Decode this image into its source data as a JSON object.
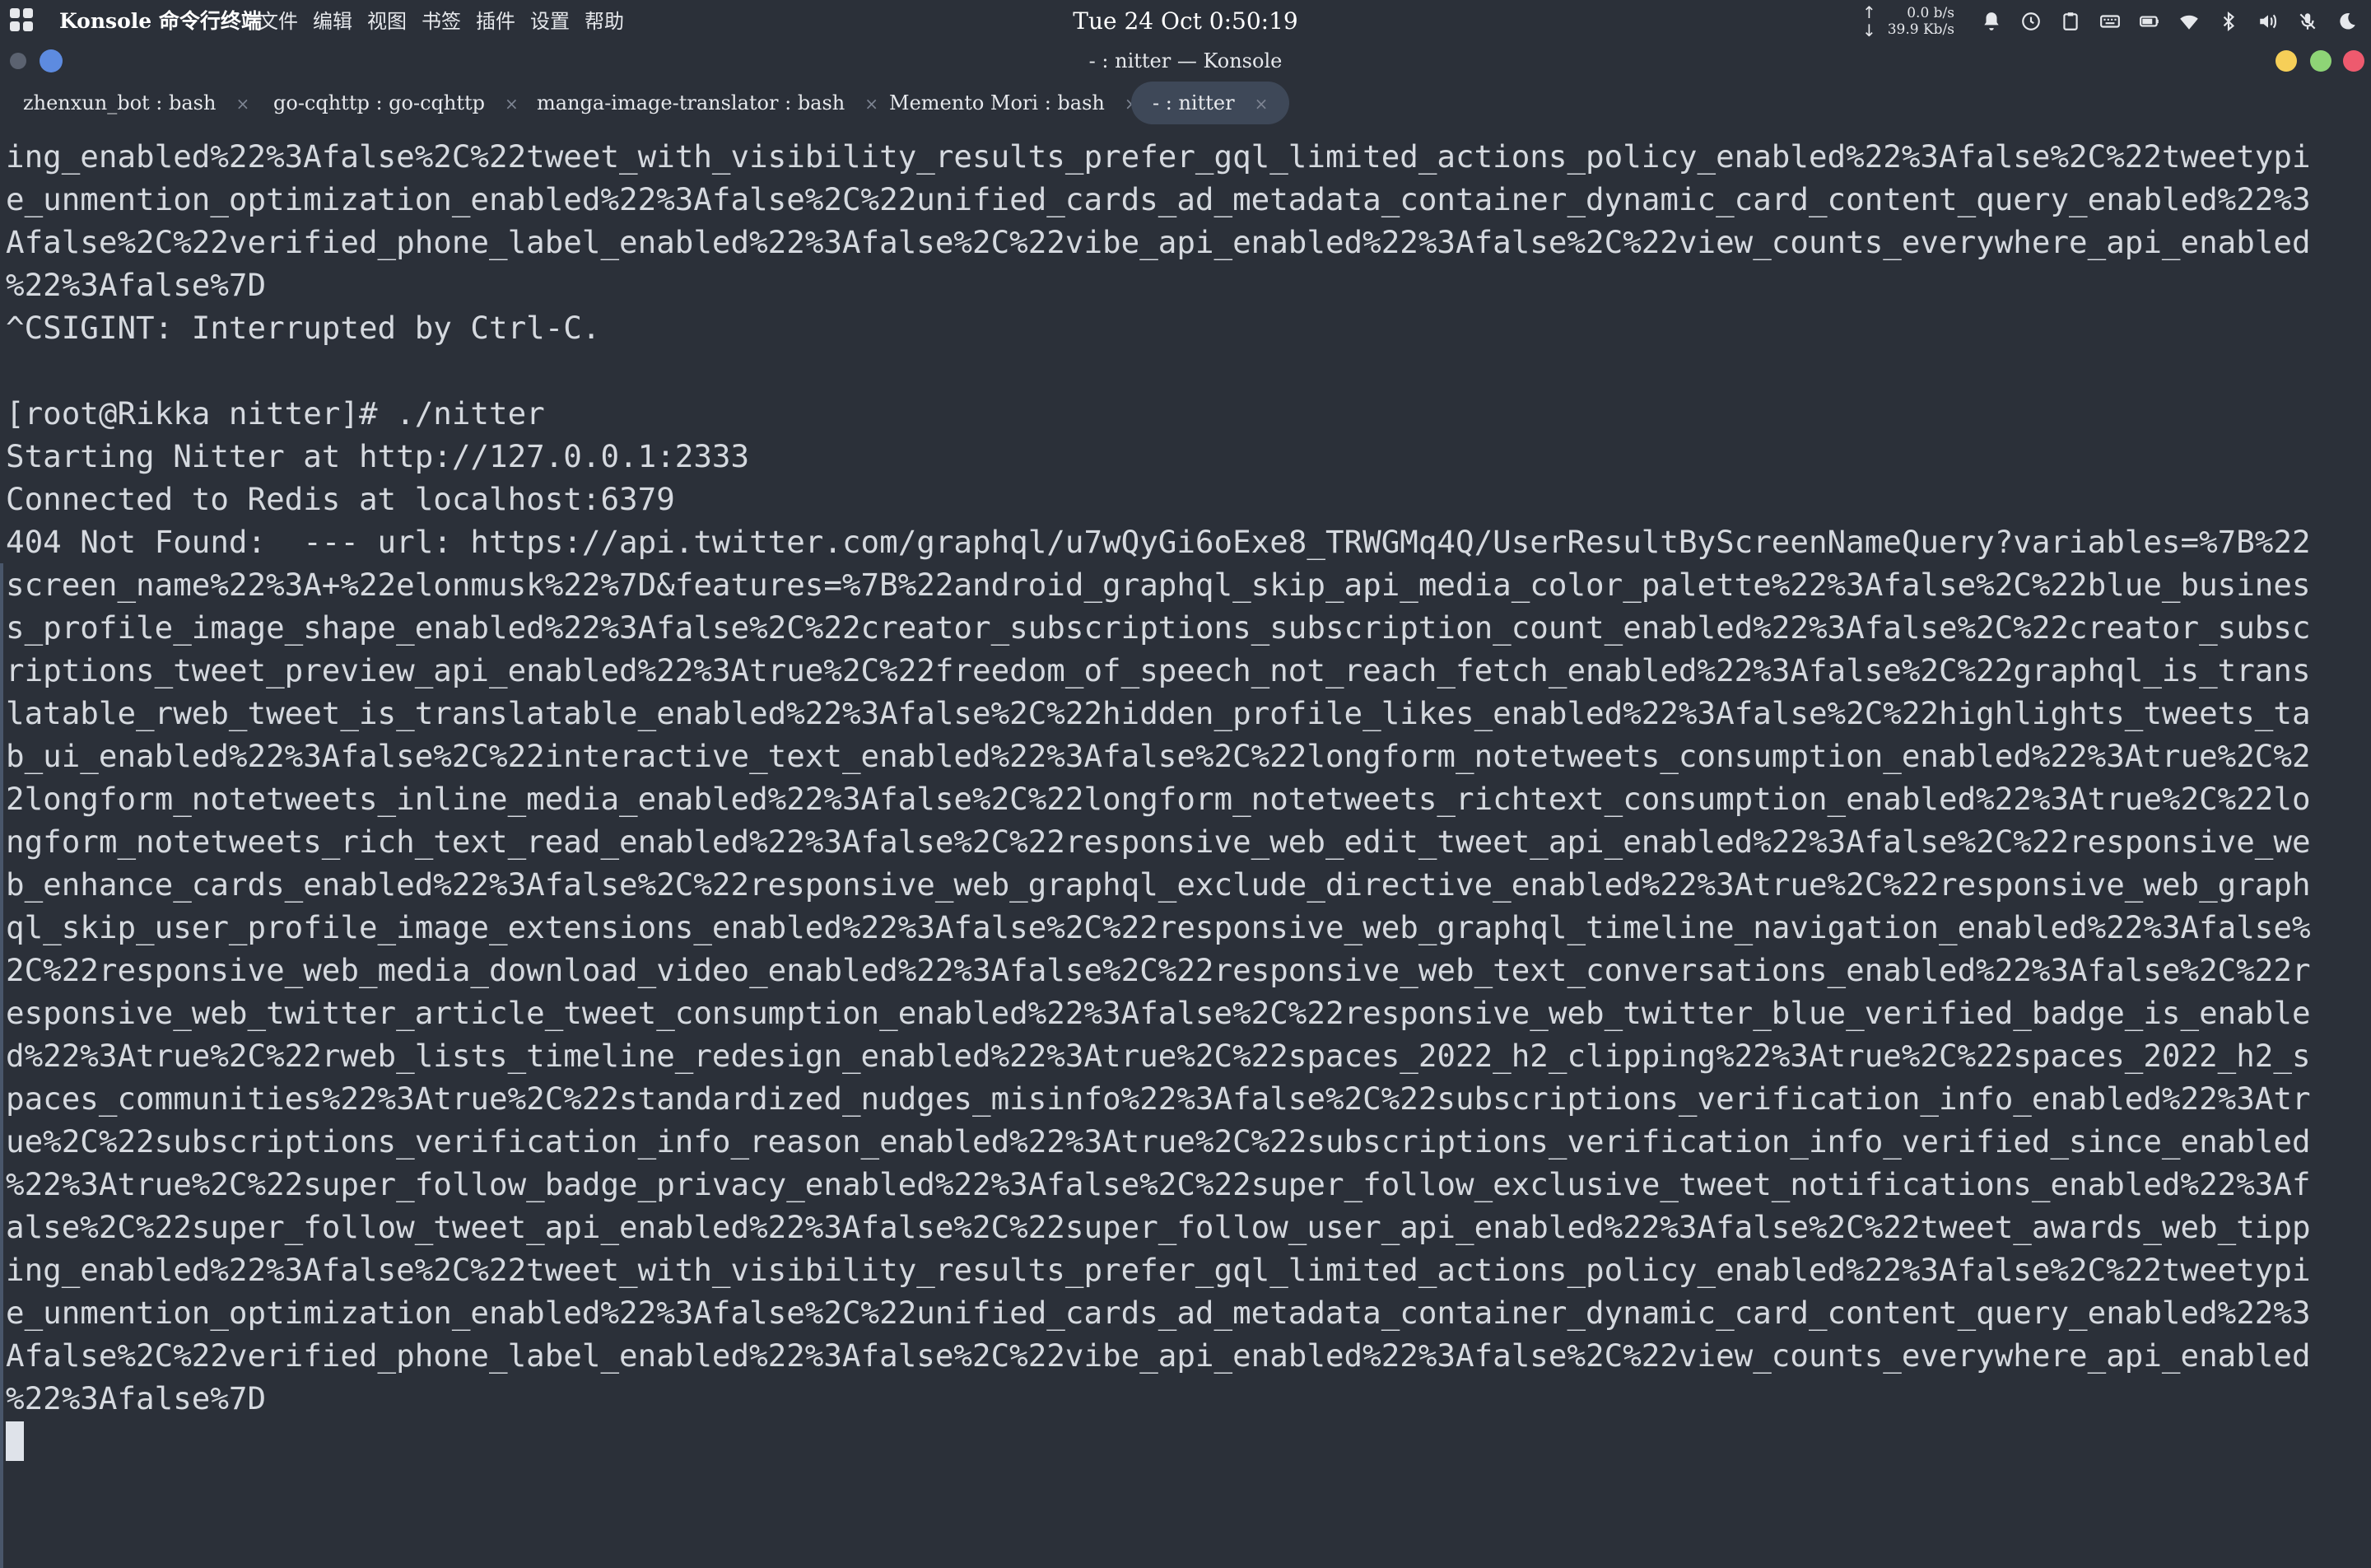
{
  "topbar": {
    "app_name": "Konsole 命令行终端",
    "menu": [
      "文件",
      "编辑",
      "视图",
      "书签",
      "插件",
      "设置",
      "帮助"
    ],
    "clock": "Tue 24 Oct   0:50:19",
    "net": {
      "up": "0.0 b/s",
      "down": "39.9 Kb/s",
      "up_arrow": "↑",
      "down_arrow": "↓"
    },
    "tray_icons": [
      "bell-icon",
      "clock-icon",
      "clipboard-icon",
      "keyboard-icon",
      "battery-icon",
      "wifi-icon",
      "bluetooth-icon",
      "volume-icon",
      "microphone-muted-icon",
      "moon-icon"
    ]
  },
  "window": {
    "title": "- : nitter — Konsole",
    "button_colors": {
      "minimize": "#f6cf58",
      "maximize": "#8ed476",
      "close": "#ee5a6e"
    }
  },
  "tabs": [
    {
      "label": "zhenxun_bot : bash",
      "active": false
    },
    {
      "label": "go-cqhttp : go-cqhttp",
      "active": false
    },
    {
      "label": "manga-image-translator : bash",
      "active": false
    },
    {
      "label": "Memento Mori : bash",
      "active": false
    },
    {
      "label": "- : nitter",
      "active": true
    }
  ],
  "tab_close_glyph": "×",
  "terminal": {
    "lines": [
      "ing_enabled%22%3Afalse%2C%22tweet_with_visibility_results_prefer_gql_limited_actions_policy_enabled%22%3Afalse%2C%22tweetypi",
      "e_unmention_optimization_enabled%22%3Afalse%2C%22unified_cards_ad_metadata_container_dynamic_card_content_query_enabled%22%3",
      "Afalse%2C%22verified_phone_label_enabled%22%3Afalse%2C%22vibe_api_enabled%22%3Afalse%2C%22view_counts_everywhere_api_enabled",
      "%22%3Afalse%7D",
      "^CSIGINT: Interrupted by Ctrl-C.",
      "",
      "[root@Rikka nitter]# ./nitter",
      "Starting Nitter at http://127.0.0.1:2333",
      "Connected to Redis at localhost:6379",
      "404 Not Found:  --- url: https://api.twitter.com/graphql/u7wQyGi6oExe8_TRWGMq4Q/UserResultByScreenNameQuery?variables=%7B%22",
      "screen_name%22%3A+%22elonmusk%22%7D&features=%7B%22android_graphql_skip_api_media_color_palette%22%3Afalse%2C%22blue_busines",
      "s_profile_image_shape_enabled%22%3Afalse%2C%22creator_subscriptions_subscription_count_enabled%22%3Afalse%2C%22creator_subsc",
      "riptions_tweet_preview_api_enabled%22%3Atrue%2C%22freedom_of_speech_not_reach_fetch_enabled%22%3Afalse%2C%22graphql_is_trans",
      "latable_rweb_tweet_is_translatable_enabled%22%3Afalse%2C%22hidden_profile_likes_enabled%22%3Afalse%2C%22highlights_tweets_ta",
      "b_ui_enabled%22%3Afalse%2C%22interactive_text_enabled%22%3Afalse%2C%22longform_notetweets_consumption_enabled%22%3Atrue%2C%2",
      "2longform_notetweets_inline_media_enabled%22%3Afalse%2C%22longform_notetweets_richtext_consumption_enabled%22%3Atrue%2C%22lo",
      "ngform_notetweets_rich_text_read_enabled%22%3Afalse%2C%22responsive_web_edit_tweet_api_enabled%22%3Afalse%2C%22responsive_we",
      "b_enhance_cards_enabled%22%3Afalse%2C%22responsive_web_graphql_exclude_directive_enabled%22%3Atrue%2C%22responsive_web_graph",
      "ql_skip_user_profile_image_extensions_enabled%22%3Afalse%2C%22responsive_web_graphql_timeline_navigation_enabled%22%3Afalse%",
      "2C%22responsive_web_media_download_video_enabled%22%3Afalse%2C%22responsive_web_text_conversations_enabled%22%3Afalse%2C%22r",
      "esponsive_web_twitter_article_tweet_consumption_enabled%22%3Afalse%2C%22responsive_web_twitter_blue_verified_badge_is_enable",
      "d%22%3Atrue%2C%22rweb_lists_timeline_redesign_enabled%22%3Atrue%2C%22spaces_2022_h2_clipping%22%3Atrue%2C%22spaces_2022_h2_s",
      "paces_communities%22%3Atrue%2C%22standardized_nudges_misinfo%22%3Afalse%2C%22subscriptions_verification_info_enabled%22%3Atr",
      "ue%2C%22subscriptions_verification_info_reason_enabled%22%3Atrue%2C%22subscriptions_verification_info_verified_since_enabled",
      "%22%3Atrue%2C%22super_follow_badge_privacy_enabled%22%3Afalse%2C%22super_follow_exclusive_tweet_notifications_enabled%22%3Af",
      "alse%2C%22super_follow_tweet_api_enabled%22%3Afalse%2C%22super_follow_user_api_enabled%22%3Afalse%2C%22tweet_awards_web_tipp",
      "ing_enabled%22%3Afalse%2C%22tweet_with_visibility_results_prefer_gql_limited_actions_policy_enabled%22%3Afalse%2C%22tweetypi",
      "e_unmention_optimization_enabled%22%3Afalse%2C%22unified_cards_ad_metadata_container_dynamic_card_content_query_enabled%22%3",
      "Afalse%2C%22verified_phone_label_enabled%22%3Afalse%2C%22vibe_api_enabled%22%3Afalse%2C%22view_counts_everywhere_api_enabled",
      "%22%3Afalse%7D"
    ]
  }
}
